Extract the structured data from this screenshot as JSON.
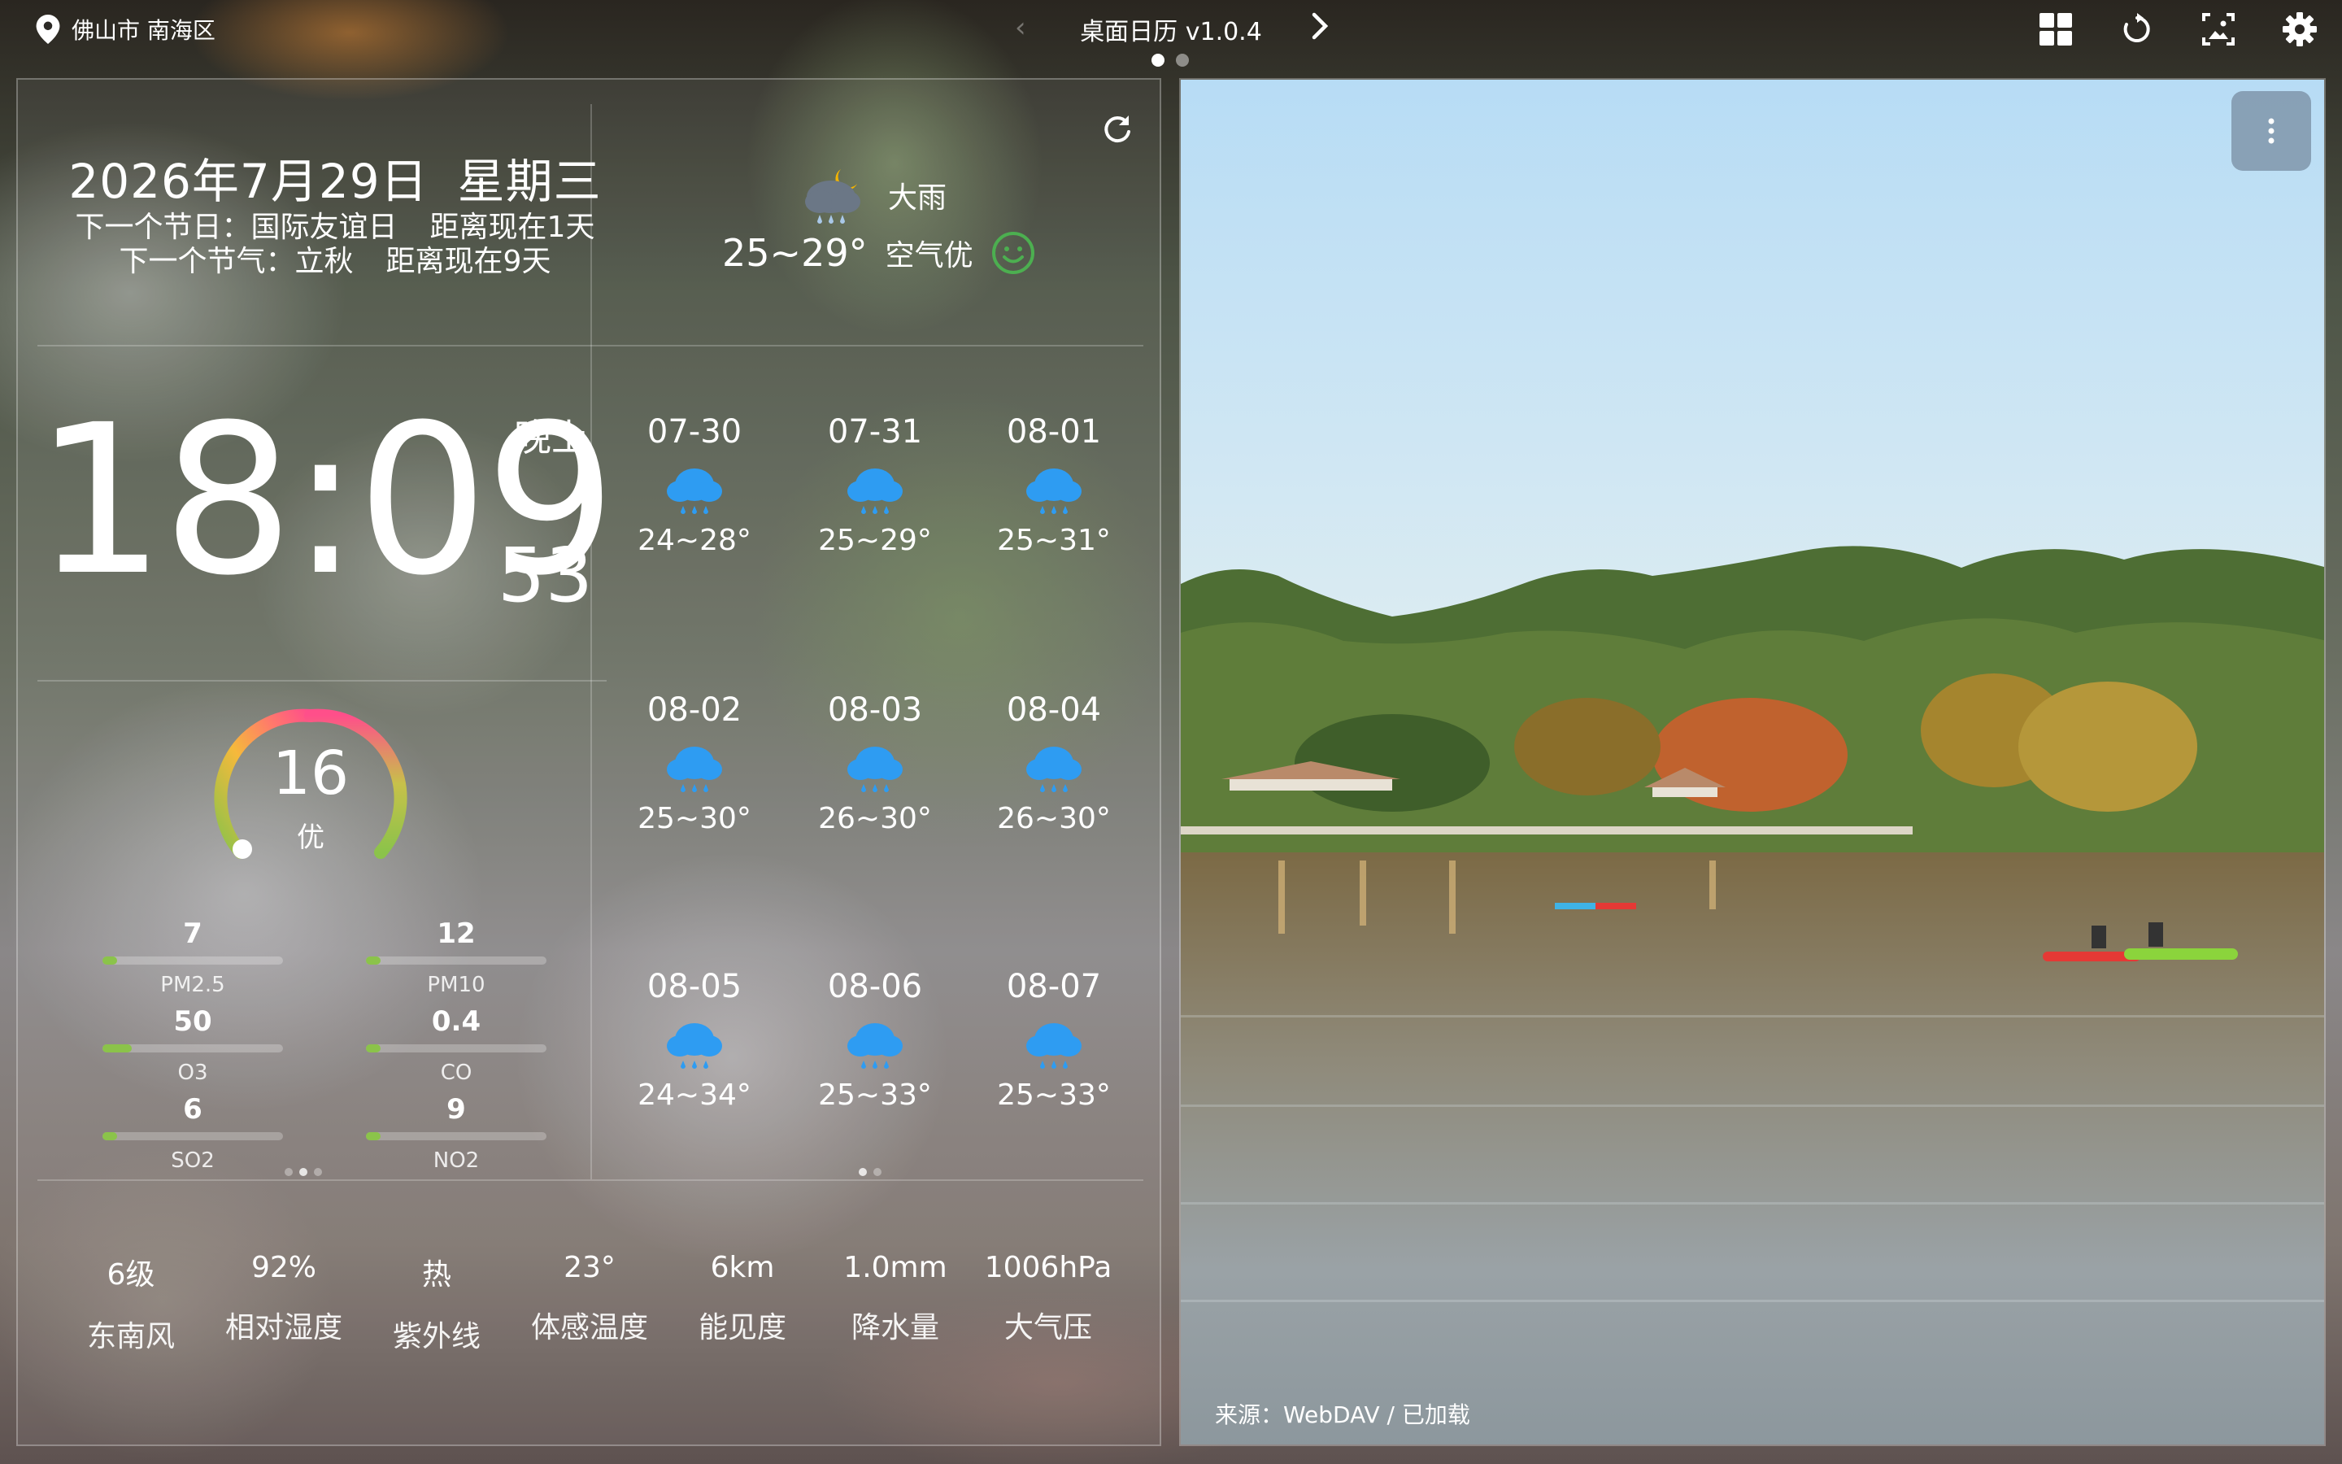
{
  "location": "佛山市 南海区",
  "app_title": "桌面日历 v1.0.4",
  "date": {
    "text": "2026年7月29日",
    "weekday": "星期三"
  },
  "next_festival": {
    "label": "下一个节日：国际友谊日",
    "distance": "距离现在1天"
  },
  "next_solar_term": {
    "label": "下一个节气：立秋",
    "distance": "距离现在9天"
  },
  "weather_now": {
    "condition": "大雨",
    "range": "25~29°",
    "air": "空气优"
  },
  "time": {
    "hm": "18:09",
    "period": "晚上",
    "seconds": "53"
  },
  "aqi": {
    "value": "16",
    "level": "优",
    "fraction": 0.05
  },
  "pollutants": [
    {
      "value": "7",
      "name": "PM2.5",
      "fraction": 0.08
    },
    {
      "value": "12",
      "name": "PM10",
      "fraction": 0.08
    },
    {
      "value": "50",
      "name": "O3",
      "fraction": 0.16
    },
    {
      "value": "0.4",
      "name": "CO",
      "fraction": 0.08
    },
    {
      "value": "6",
      "name": "SO2",
      "fraction": 0.08
    },
    {
      "value": "9",
      "name": "NO2",
      "fraction": 0.08
    }
  ],
  "forecast": [
    {
      "date": "07-30",
      "range": "24~28°"
    },
    {
      "date": "07-31",
      "range": "25~29°"
    },
    {
      "date": "08-01",
      "range": "25~31°"
    },
    {
      "date": "08-02",
      "range": "25~30°"
    },
    {
      "date": "08-03",
      "range": "26~30°"
    },
    {
      "date": "08-04",
      "range": "26~30°"
    },
    {
      "date": "08-05",
      "range": "24~34°"
    },
    {
      "date": "08-06",
      "range": "25~33°"
    },
    {
      "date": "08-07",
      "range": "25~33°"
    }
  ],
  "stats": [
    {
      "value": "6级",
      "name": "东南风"
    },
    {
      "value": "92%",
      "name": "相对湿度"
    },
    {
      "value": "热",
      "name": "紫外线"
    },
    {
      "value": "23°",
      "name": "体感温度"
    },
    {
      "value": "6km",
      "name": "能见度"
    },
    {
      "value": "1.0mm",
      "name": "降水量"
    },
    {
      "value": "1006hPa",
      "name": "大气压"
    }
  ],
  "photo_caption": "来源：WebDAV / 已加载",
  "colors": {
    "aqi_good": "#8bc34a",
    "smile": "#4caf50",
    "rain_icon": "#2e9cf2"
  },
  "icons": [
    "location-pin-icon",
    "chevron-left-icon",
    "chevron-right-icon",
    "grid-icon",
    "refresh-icon",
    "image-icon",
    "gear-icon",
    "rain-icon",
    "smile-icon",
    "more-vertical-icon"
  ]
}
